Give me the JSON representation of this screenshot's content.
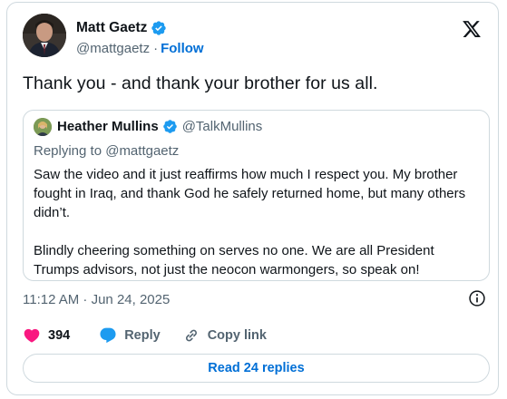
{
  "author": {
    "name": "Matt Gaetz",
    "handle": "@mattgaetz",
    "separator": "·",
    "follow_label": "Follow"
  },
  "tweet": {
    "text": "Thank you - and thank your brother for us all."
  },
  "quoted": {
    "name": "Heather Mullins",
    "handle": "@TalkMullins",
    "replying_to": "Replying to @mattgaetz",
    "paragraphs": [
      "Saw the video and it just reaffirms how much I respect you. My brother fought in Iraq, and thank God he safely returned home, but many others didn’t.",
      "Blindly cheering something on serves no one. We are all President Trumps advisors, not just the neocon warmongers, so speak on!"
    ]
  },
  "meta": {
    "timestamp": "11:12 AM · Jun 24, 2025"
  },
  "actions": {
    "like_count": "394",
    "reply_label": "Reply",
    "copy_link_label": "Copy link"
  },
  "read_replies_label": "Read 24 replies",
  "colors": {
    "verified": "#1d9bf0",
    "like": "#f91880",
    "reply": "#1d9bf0",
    "link": "#006fd6",
    "muted": "#536471",
    "border": "#cfd9de"
  },
  "icons": [
    "verified-badge-icon",
    "x-logo-icon",
    "info-icon",
    "heart-icon",
    "reply-bubble-icon",
    "link-icon"
  ]
}
